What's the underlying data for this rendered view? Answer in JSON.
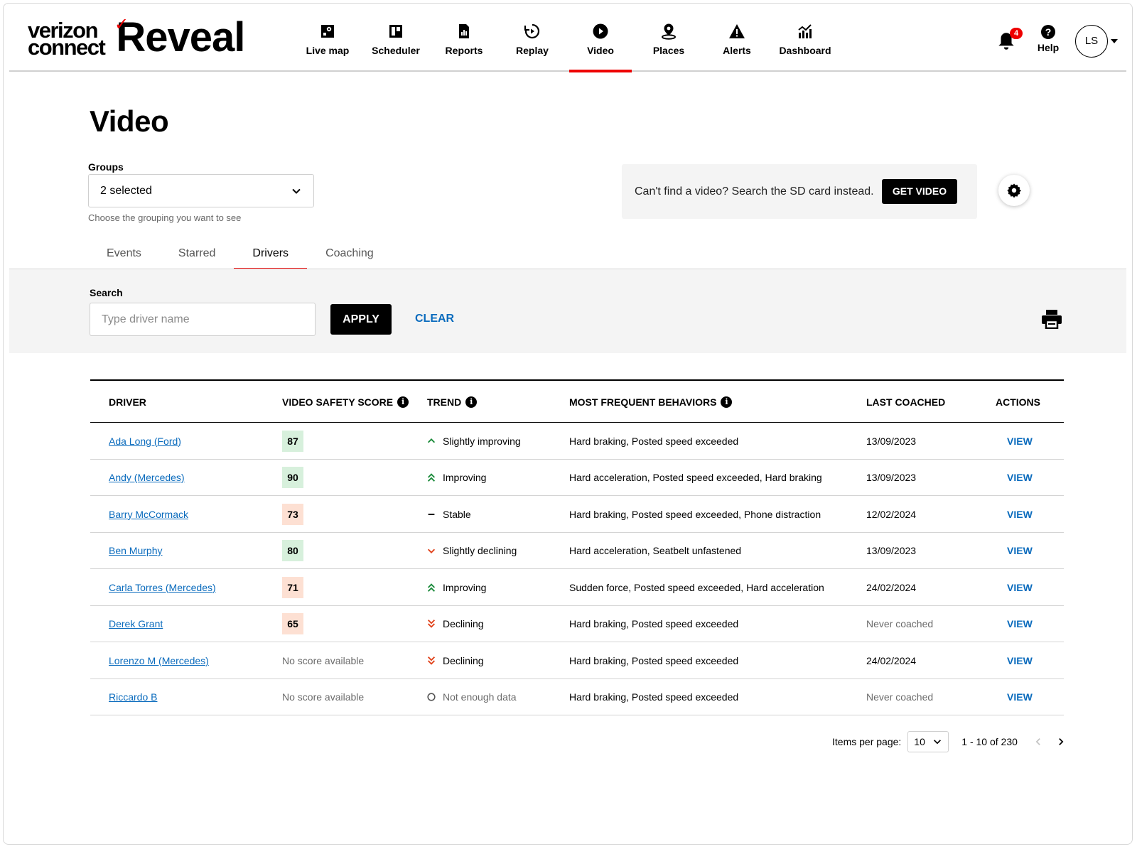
{
  "brand": {
    "company": "verizon connect",
    "line1": "verizon",
    "line2": "connect",
    "product": "Reveal",
    "accent": "#ee0000"
  },
  "nav": {
    "items": [
      {
        "label": "Live map",
        "icon": "map-icon"
      },
      {
        "label": "Scheduler",
        "icon": "scheduler-icon"
      },
      {
        "label": "Reports",
        "icon": "reports-icon"
      },
      {
        "label": "Replay",
        "icon": "replay-icon"
      },
      {
        "label": "Video",
        "icon": "video-play-icon",
        "active": true
      },
      {
        "label": "Places",
        "icon": "places-pin-icon"
      },
      {
        "label": "Alerts",
        "icon": "alert-triangle-icon"
      },
      {
        "label": "Dashboard",
        "icon": "dashboard-chart-icon"
      }
    ],
    "notifications_count": "4",
    "help_label": "Help",
    "user_initials": "LS"
  },
  "page": {
    "title": "Video",
    "groups": {
      "label": "Groups",
      "value": "2 selected",
      "helper": "Choose the grouping you want to see"
    },
    "sd_card": {
      "text": "Can't find a video? Search the SD card instead.",
      "button": "GET VIDEO"
    },
    "tabs": [
      {
        "label": "Events"
      },
      {
        "label": "Starred"
      },
      {
        "label": "Drivers",
        "active": true
      },
      {
        "label": "Coaching"
      }
    ],
    "search": {
      "label": "Search",
      "placeholder": "Type driver name",
      "value": "",
      "apply": "APPLY",
      "clear": "CLEAR"
    }
  },
  "table": {
    "headers": {
      "driver": "DRIVER",
      "score": "VIDEO SAFETY SCORE",
      "trend": "TREND",
      "behaviors": "MOST FREQUENT BEHAVIORS",
      "last_coached": "LAST COACHED",
      "actions": "ACTIONS"
    },
    "rows": [
      {
        "driver": "Ada Long (Ford)",
        "score": "87",
        "score_level": "good",
        "trend": "Slightly improving",
        "trend_icon": "chevron-up",
        "behaviors": "Hard braking, Posted speed exceeded",
        "last_coached": "13/09/2023",
        "action": "VIEW"
      },
      {
        "driver": "Andy (Mercedes)",
        "score": "90",
        "score_level": "good",
        "trend": "Improving",
        "trend_icon": "double-chevron-up",
        "behaviors": "Hard acceleration, Posted speed exceeded, Hard braking",
        "last_coached": "13/09/2023",
        "action": "VIEW"
      },
      {
        "driver": "Barry McCormack",
        "score": "73",
        "score_level": "warn",
        "trend": "Stable",
        "trend_icon": "dash",
        "behaviors": "Hard braking, Posted speed exceeded, Phone distraction",
        "last_coached": "12/02/2024",
        "action": "VIEW"
      },
      {
        "driver": "Ben Murphy",
        "score": "80",
        "score_level": "good",
        "trend": "Slightly declining",
        "trend_icon": "chevron-down",
        "behaviors": "Hard acceleration, Seatbelt unfastened",
        "last_coached": "13/09/2023",
        "action": "VIEW"
      },
      {
        "driver": "Carla Torres (Mercedes)",
        "score": "71",
        "score_level": "warn",
        "trend": "Improving",
        "trend_icon": "double-chevron-up",
        "behaviors": "Sudden force, Posted speed exceeded, Hard acceleration",
        "last_coached": "24/02/2024",
        "action": "VIEW"
      },
      {
        "driver": "Derek Grant",
        "score": "65",
        "score_level": "warn",
        "trend": "Declining",
        "trend_icon": "double-chevron-down",
        "behaviors": "Hard braking, Posted speed exceeded",
        "last_coached": "Never coached",
        "last_coached_muted": true,
        "action": "VIEW"
      },
      {
        "driver": "Lorenzo M (Mercedes)",
        "score": "No score available",
        "score_level": "none",
        "trend": "Declining",
        "trend_icon": "double-chevron-down",
        "behaviors": "Hard braking, Posted speed exceeded",
        "last_coached": "24/02/2024",
        "action": "VIEW"
      },
      {
        "driver": "Riccardo B",
        "score": "No score available",
        "score_level": "none",
        "trend": "Not enough data",
        "trend_icon": "circle",
        "behaviors": "Hard braking, Posted speed exceeded",
        "last_coached": "Never coached",
        "last_coached_muted": true,
        "action": "VIEW"
      }
    ]
  },
  "pagination": {
    "label": "Items per page:",
    "per_page": "10",
    "range": "1 - 10 of 230"
  },
  "colors": {
    "link": "#0a6bbd",
    "good_score_bg": "#d7f0dc",
    "warn_score_bg": "#fde0d3",
    "trend_up": "#1a8a3a",
    "trend_down": "#e0431c"
  }
}
